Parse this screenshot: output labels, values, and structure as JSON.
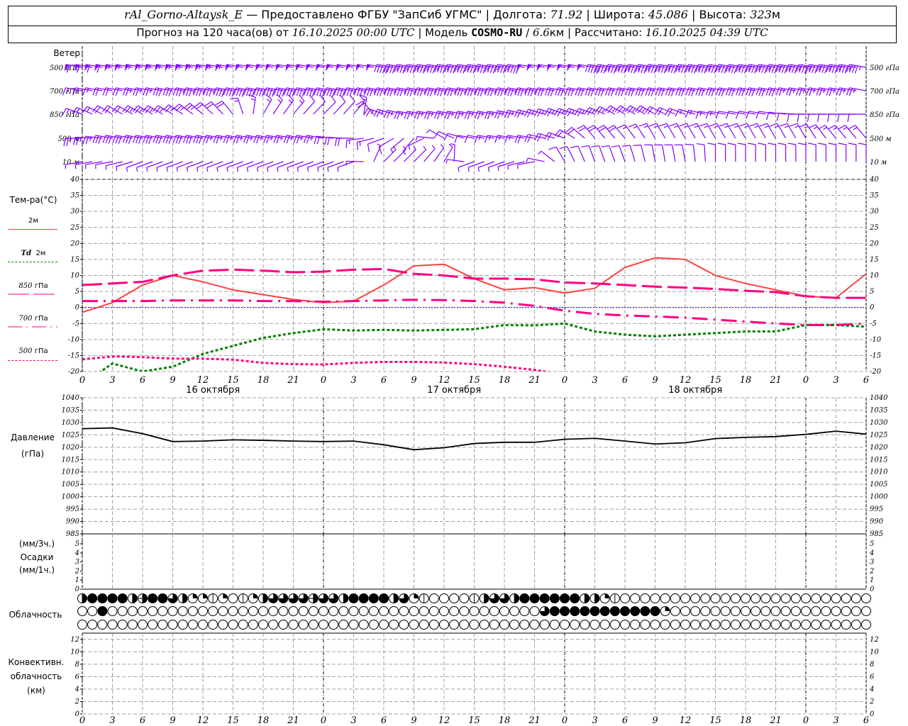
{
  "header": {
    "station": "rAl_Gorno-Altaysk_E",
    "provided": "— Предоставлено ФГБУ \"ЗапСиб УГМС\"",
    "lon_label": "Долгота:",
    "lon": "71.92",
    "lat_label": "Широта:",
    "lat": "45.086",
    "alt_label": "Высота:",
    "alt": "323",
    "alt_unit": "м",
    "forecast_label": "Прогноз на 120 часа(ов) от",
    "forecast_start": "16.10.2025 00:00 UTC",
    "model_label": "Модель",
    "model": "COSMO-RU",
    "resolution": "6.6",
    "res_unit": "км",
    "computed_label": "Рассчитано:",
    "computed": "16.10.2025 04:39 UTC",
    "sep": "|"
  },
  "labels": {
    "wind": "Ветер",
    "temp": "Тем-ра(°С)",
    "t2m": "2м",
    "td_sym": "Td",
    "td_lvl": "2м",
    "l850_num": "850",
    "l700_num": "700",
    "l500_num": "500",
    "hpa": "гПа",
    "pressure": "Давление",
    "pressure_unit": "(гПа)",
    "precip_3h": "(мм/3ч.)",
    "precip": "Осадки",
    "precip_1h": "(мм/1ч.)",
    "cloud": "Облачность",
    "conv1": "Конвективн.",
    "conv2": "облачность",
    "conv3": "(км)"
  },
  "colors": {
    "wind": "#8000ff",
    "t2m": "#ff4040",
    "td2m": "#008000",
    "levels": "#ff0080",
    "zero": "#0000ff",
    "grid": "#a0a0a0",
    "pressure": "#000000"
  },
  "time_axis": {
    "tick_labels": [
      "0",
      "3",
      "6",
      "9",
      "12",
      "15",
      "18",
      "21",
      "0",
      "3",
      "6",
      "9",
      "12",
      "15",
      "18",
      "21",
      "0",
      "3",
      "6",
      "9",
      "12",
      "15",
      "18",
      "21",
      "0",
      "3",
      "6"
    ],
    "dates": [
      "16 октября",
      "17 октября",
      "18 октября"
    ]
  },
  "chart_data": [
    {
      "type": "wind-barbs",
      "title": "Ветер",
      "units_note": "",
      "x_hours": [
        0,
        3,
        6,
        9,
        12,
        15,
        18,
        21,
        24,
        27,
        30,
        33,
        36,
        39,
        42,
        45,
        48,
        51,
        54,
        57,
        60,
        63,
        66,
        69,
        72,
        75,
        78
      ],
      "levels": [
        {
          "name": "500 гПа",
          "dir": [
            280,
            280,
            280,
            280,
            280,
            280,
            280,
            280,
            280,
            280,
            280,
            280,
            280,
            280,
            280,
            280,
            280,
            280,
            280,
            280,
            280,
            280,
            280,
            280,
            280,
            280,
            280
          ],
          "speed": [
            30,
            30,
            28,
            28,
            27,
            27,
            26,
            26,
            25,
            25,
            25,
            24,
            24,
            24,
            24,
            25,
            25,
            25,
            24,
            24,
            24,
            23,
            23,
            22,
            22,
            22,
            22
          ]
        },
        {
          "name": "700 гПа",
          "dir": [
            280,
            280,
            280,
            280,
            280,
            280,
            280,
            280,
            280,
            280,
            280,
            280,
            280,
            280,
            280,
            280,
            280,
            280,
            280,
            280,
            280,
            280,
            280,
            280,
            280,
            280,
            280
          ],
          "speed": [
            8,
            10,
            12,
            15,
            18,
            20,
            20,
            20,
            20,
            20,
            18,
            18,
            18,
            18,
            18,
            18,
            16,
            16,
            16,
            15,
            15,
            15,
            15,
            15,
            14,
            14,
            14
          ]
        },
        {
          "name": "850 гПа",
          "dir": [
            290,
            300,
            300,
            300,
            310,
            320,
            30,
            40,
            45,
            40,
            290,
            280,
            280,
            280,
            280,
            285,
            290,
            290,
            300,
            300,
            290,
            280,
            280,
            280,
            270,
            270,
            270
          ],
          "speed": [
            8,
            10,
            12,
            12,
            12,
            10,
            8,
            7,
            6,
            6,
            12,
            12,
            12,
            12,
            12,
            12,
            12,
            12,
            12,
            12,
            10,
            8,
            6,
            6,
            6,
            5,
            5
          ]
        },
        {
          "name": "500 м",
          "dir": [
            270,
            280,
            280,
            280,
            280,
            280,
            280,
            280,
            280,
            270,
            250,
            220,
            300,
            280,
            280,
            280,
            290,
            320,
            320,
            330,
            330,
            330,
            330,
            330,
            330,
            320,
            320
          ],
          "speed": [
            12,
            15,
            16,
            16,
            15,
            14,
            12,
            12,
            12,
            10,
            6,
            3,
            4,
            6,
            8,
            10,
            10,
            10,
            10,
            8,
            8,
            8,
            8,
            7,
            7,
            7,
            7
          ]
        },
        {
          "name": "10 м",
          "dir": [
            260,
            260,
            250,
            250,
            250,
            250,
            250,
            250,
            250,
            250,
            45,
            45,
            30,
            250,
            250,
            260,
            330,
            340,
            340,
            350,
            350,
            0,
            0,
            0,
            0,
            0,
            0
          ],
          "speed": [
            4,
            4,
            3,
            3,
            3,
            3,
            3,
            3,
            3,
            3,
            3,
            2,
            3,
            2,
            3,
            3,
            5,
            5,
            5,
            5,
            5,
            5,
            5,
            5,
            5,
            5,
            5
          ]
        }
      ]
    },
    {
      "type": "line",
      "ylabel": "Тем-ра(°С)",
      "ylim": [
        -20,
        40
      ],
      "y_ticks": [
        "40",
        "35",
        "30",
        "25",
        "20",
        "15",
        "10",
        "5",
        "0",
        "-5",
        "-10",
        "-15",
        "-20"
      ],
      "grid": true,
      "x_hours": [
        0,
        3,
        6,
        9,
        12,
        15,
        18,
        21,
        24,
        27,
        30,
        33,
        36,
        39,
        42,
        45,
        48,
        51,
        54,
        57,
        60,
        63,
        66,
        69,
        72,
        75,
        78
      ],
      "series": [
        {
          "name": "2м",
          "style": "solid",
          "values": [
            -1.5,
            1.5,
            7,
            10,
            8,
            5.5,
            4,
            2.5,
            1.5,
            2,
            7,
            13,
            13.5,
            9,
            5.5,
            6.2,
            4.5,
            6,
            12.5,
            15.5,
            15,
            10,
            7.5,
            5.5,
            3.5,
            3,
            10.5
          ]
        },
        {
          "name": "Td 2м",
          "style": "dotted-green",
          "values": [
            -24,
            -17.5,
            -20,
            -18.5,
            -14.5,
            -12,
            -9.5,
            -8,
            -6.8,
            -7.2,
            -7,
            -7.2,
            -7,
            -6.8,
            -5.5,
            -5.6,
            -5,
            -7.5,
            -8.5,
            -9,
            -8.5,
            -8,
            -7.5,
            -7.5,
            -5.5,
            -5.5,
            -6
          ]
        },
        {
          "name": "850 гПа",
          "style": "long-dash",
          "values": [
            7,
            7.5,
            8,
            10,
            11.5,
            11.8,
            11.5,
            11,
            11.2,
            11.8,
            12,
            10.5,
            10,
            9,
            9,
            8.8,
            7.8,
            7.5,
            7,
            6.5,
            6.2,
            5.8,
            5.2,
            4.8,
            3.5,
            3,
            3
          ]
        },
        {
          "name": "700 гПа",
          "style": "dash-dot",
          "values": [
            2,
            2,
            2,
            2.2,
            2.2,
            2.2,
            2,
            2,
            1.8,
            2,
            2.2,
            2.4,
            2.3,
            2,
            1.5,
            0.5,
            -1,
            -2,
            -2.5,
            -2.8,
            -3.2,
            -3.8,
            -4.4,
            -5,
            -5.5,
            -5.5,
            -5
          ]
        },
        {
          "name": "500 гПа",
          "style": "dotted",
          "values": [
            -16.2,
            -15.3,
            -15.5,
            -16,
            -16,
            -16.3,
            -17.3,
            -17.7,
            -17.8,
            -17.3,
            -17,
            -17,
            -17.2,
            -17.7,
            -18.5,
            -19.5,
            -21,
            null,
            null,
            null,
            null,
            null,
            null,
            null,
            null,
            null,
            null
          ]
        }
      ]
    },
    {
      "type": "line",
      "ylabel": "Давление (гПа)",
      "ylim": [
        985,
        1040
      ],
      "y_ticks": [
        "1040",
        "1035",
        "1030",
        "1025",
        "1020",
        "1015",
        "1010",
        "1005",
        "1000",
        "995",
        "990",
        "985"
      ],
      "grid": true,
      "x_hours": [
        0,
        3,
        6,
        9,
        12,
        15,
        18,
        21,
        24,
        27,
        30,
        33,
        36,
        39,
        42,
        45,
        48,
        51,
        54,
        57,
        60,
        63,
        66,
        69,
        72,
        75,
        78
      ],
      "series": [
        {
          "values": [
            1027.5,
            1027.8,
            1025.5,
            1022.3,
            1022.5,
            1023,
            1022.8,
            1022.5,
            1022.3,
            1022.5,
            1021,
            1019,
            1019.8,
            1021.5,
            1022,
            1022,
            1023.2,
            1023.6,
            1022.5,
            1021.3,
            1021.8,
            1023.5,
            1024,
            1024.3,
            1025.2,
            1026.5,
            1025.3
          ]
        }
      ]
    },
    {
      "type": "bar",
      "ylabel": "Осадки (мм/3ч.) (мм/1ч.)",
      "ylim": [
        0,
        6
      ],
      "y_ticks": [
        "5",
        "4",
        "3",
        "2",
        "1",
        "0"
      ],
      "values": []
    },
    {
      "type": "symbols",
      "ylabel": "Облачность",
      "cloud_octas": {
        "upper": [
          4,
          8,
          8,
          8,
          8,
          4,
          5,
          8,
          8,
          6,
          4,
          2,
          2,
          1,
          2,
          0,
          1,
          2,
          4,
          6,
          6,
          6,
          6,
          5,
          6,
          6,
          4,
          8,
          8,
          8,
          8,
          4,
          6,
          2,
          1,
          0,
          0,
          0,
          0,
          1,
          4,
          6,
          6,
          4,
          8,
          8,
          8,
          8,
          8,
          8,
          4,
          4,
          2,
          1,
          0,
          0,
          0,
          0,
          0,
          0,
          0,
          0,
          0,
          0,
          0,
          0,
          0,
          0,
          0,
          0,
          0,
          0,
          0,
          0,
          0,
          0,
          0,
          0,
          0
        ],
        "middle": [
          0,
          0,
          8,
          0,
          0,
          0,
          0,
          0,
          0,
          0,
          0,
          0,
          0,
          0,
          0,
          0,
          0,
          0,
          0,
          0,
          0,
          0,
          0,
          0,
          0,
          0,
          0,
          0,
          0,
          0,
          0,
          0,
          0,
          0,
          0,
          0,
          0,
          0,
          0,
          0,
          0,
          0,
          0,
          0,
          0,
          0,
          6,
          8,
          8,
          8,
          8,
          8,
          8,
          8,
          8,
          8,
          8,
          8,
          2,
          0,
          0,
          0,
          0,
          0,
          0,
          0,
          0,
          0,
          0,
          0,
          0,
          0,
          0,
          0,
          0,
          0,
          0,
          0,
          0
        ],
        "lower": [
          0,
          0,
          0,
          0,
          0,
          0,
          0,
          0,
          0,
          0,
          0,
          0,
          0,
          0,
          0,
          0,
          0,
          0,
          0,
          0,
          0,
          0,
          0,
          0,
          0,
          0,
          0,
          0,
          0,
          0,
          0,
          0,
          0,
          0,
          0,
          0,
          0,
          0,
          0,
          0,
          0,
          0,
          0,
          0,
          0,
          0,
          0,
          0,
          0,
          0,
          0,
          0,
          0,
          0,
          0,
          0,
          0,
          0,
          0,
          0,
          0,
          0,
          0,
          0,
          0,
          0,
          0,
          0,
          0,
          0,
          0,
          0,
          0,
          0,
          0,
          0,
          0,
          0,
          0
        ]
      }
    },
    {
      "type": "bar",
      "ylabel": "Конвективн. облачность (км)",
      "ylim": [
        0,
        13
      ],
      "y_ticks": [
        "12",
        "10",
        "8",
        "6",
        "4",
        "2",
        "0"
      ],
      "values": []
    }
  ]
}
